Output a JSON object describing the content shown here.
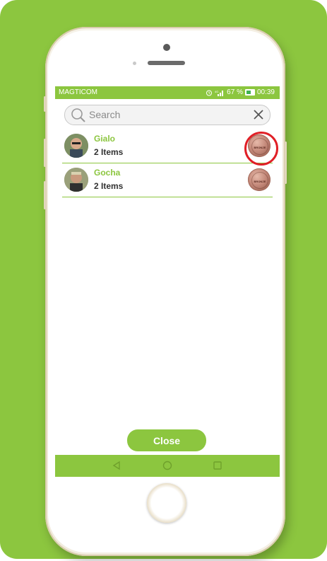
{
  "status_bar": {
    "carrier": "MAGTICOM",
    "battery_percent": "67 %",
    "time": "00:39"
  },
  "search": {
    "placeholder": "Search"
  },
  "list": [
    {
      "name": "Gialo",
      "count": "2 Items",
      "badge": "BRONZE"
    },
    {
      "name": "Gocha",
      "count": "2 Items",
      "badge": "BRONZE"
    }
  ],
  "footer": {
    "close_label": "Close"
  },
  "colors": {
    "accent": "#8cc63f",
    "highlight": "#e01f26",
    "text_dark": "#333333"
  },
  "icons": [
    "search-icon",
    "close-icon",
    "alarm-icon",
    "signal-icon",
    "battery-icon",
    "back-icon",
    "home-icon",
    "recents-icon"
  ]
}
